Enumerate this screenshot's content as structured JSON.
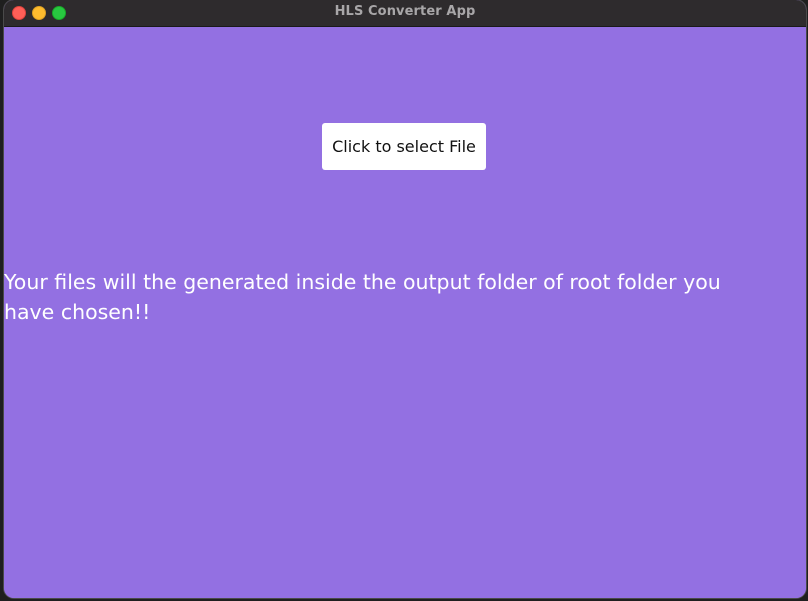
{
  "window": {
    "title": "HLS Converter App",
    "background_color": "#9370e2"
  },
  "traffic_lights": {
    "close": "#ff5f57",
    "minimize": "#febc2e",
    "maximize": "#28c840"
  },
  "main": {
    "select_button_label": "Click to select File",
    "info_text": "Your files will the generated inside the output folder of root folder you have chosen!!"
  }
}
